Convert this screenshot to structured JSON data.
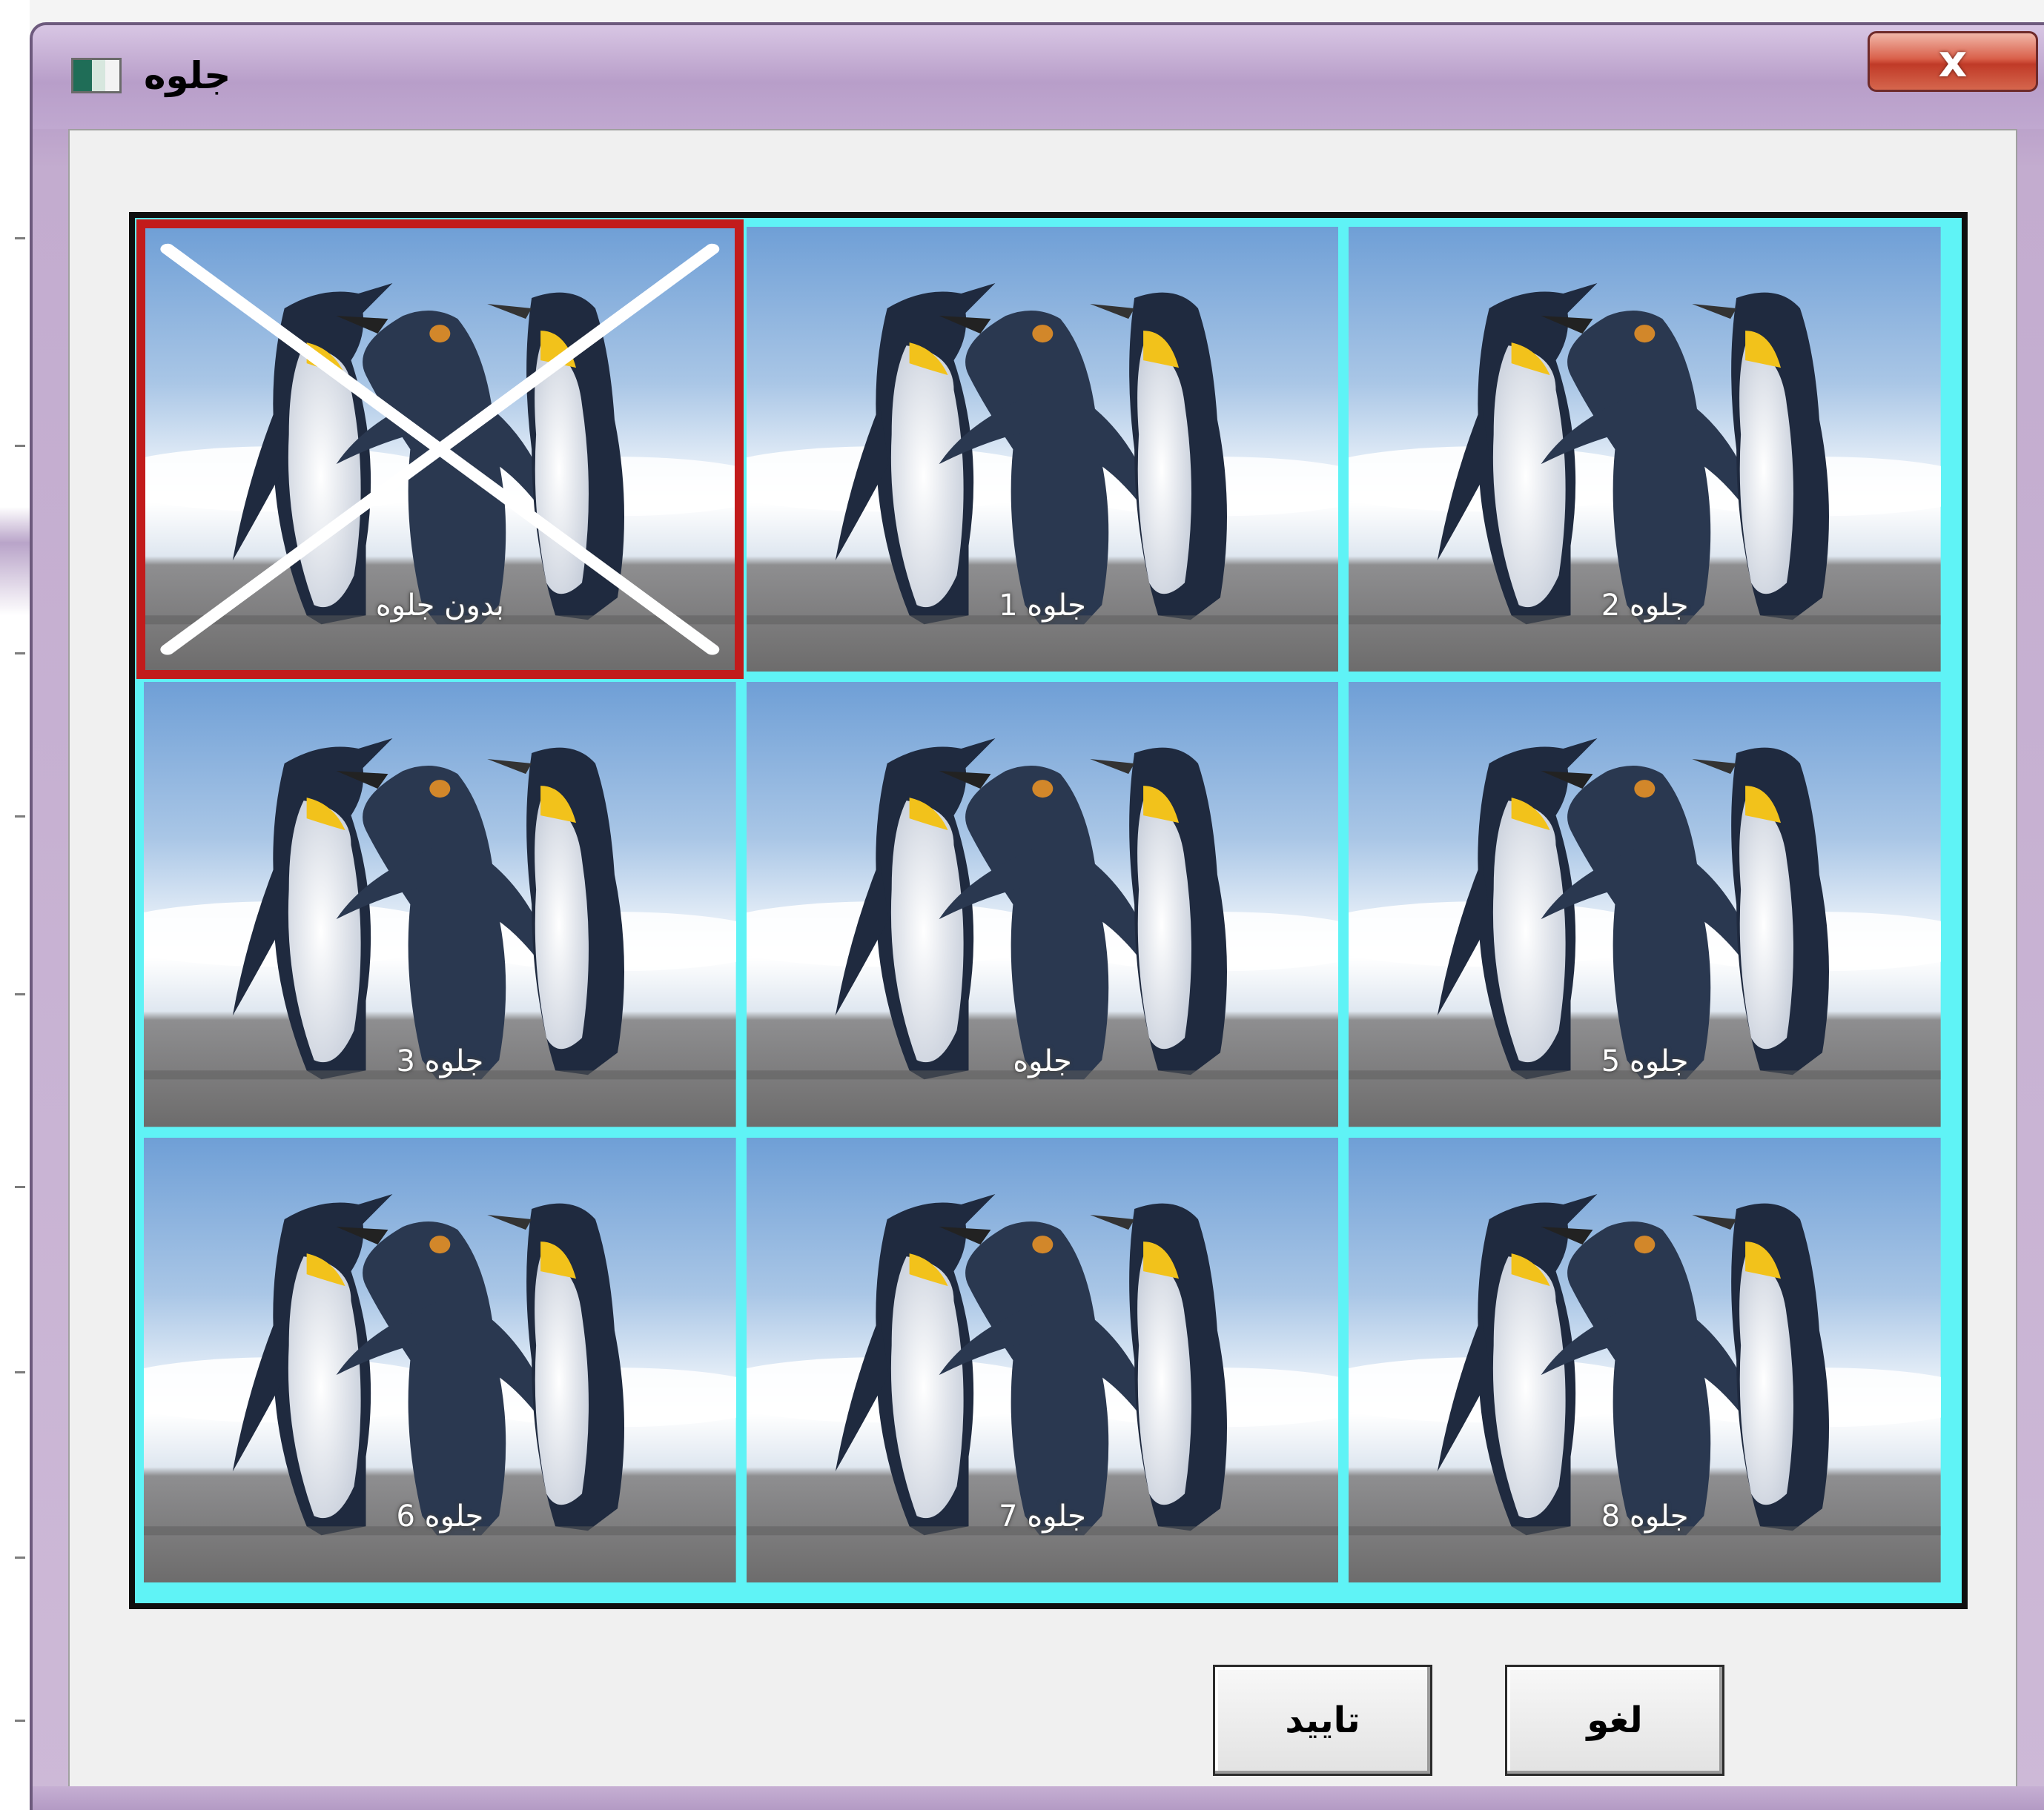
{
  "window": {
    "title": "جلوه",
    "close_label": "x"
  },
  "effects": [
    {
      "label": "بدون جلوه",
      "selected": true
    },
    {
      "label": "جلوه 1",
      "selected": false
    },
    {
      "label": "جلوه 2",
      "selected": false
    },
    {
      "label": "جلوه 3",
      "selected": false
    },
    {
      "label": "جلوه",
      "selected": false
    },
    {
      "label": "جلوه 5",
      "selected": false
    },
    {
      "label": "جلوه 6",
      "selected": false
    },
    {
      "label": "جلوه 7",
      "selected": false
    },
    {
      "label": "جلوه 8",
      "selected": false
    }
  ],
  "buttons": {
    "ok_label": "تایید",
    "cancel_label": "لغو"
  },
  "colors": {
    "selection_border": "#c21b1b",
    "grid_border": "#5ff3f6",
    "title_bar": "#b89ec9",
    "close_button": "#c03a27"
  }
}
